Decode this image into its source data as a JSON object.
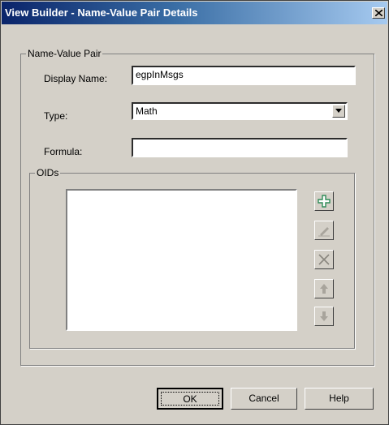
{
  "window": {
    "title": "View Builder - Name-Value Pair Details",
    "close_glyph": "close-icon"
  },
  "group_nvp": {
    "legend": "Name-Value Pair"
  },
  "display_name": {
    "label": "Display Name:",
    "value": "egpInMsgs"
  },
  "type": {
    "label": "Type:",
    "selected": "Math"
  },
  "formula": {
    "label": "Formula:",
    "value": ""
  },
  "group_oids": {
    "legend": "OIDs"
  },
  "oid_tools": [
    "add-icon",
    "edit-icon",
    "delete-icon",
    "move-up-icon",
    "move-down-icon"
  ],
  "buttons": {
    "ok": "OK",
    "cancel": "Cancel",
    "help": "Help"
  },
  "colors": {
    "dialog": "#d4d0c8",
    "title_start": "#0a246a",
    "title_end": "#a6caf0",
    "add_icon": "#2e8b57"
  }
}
